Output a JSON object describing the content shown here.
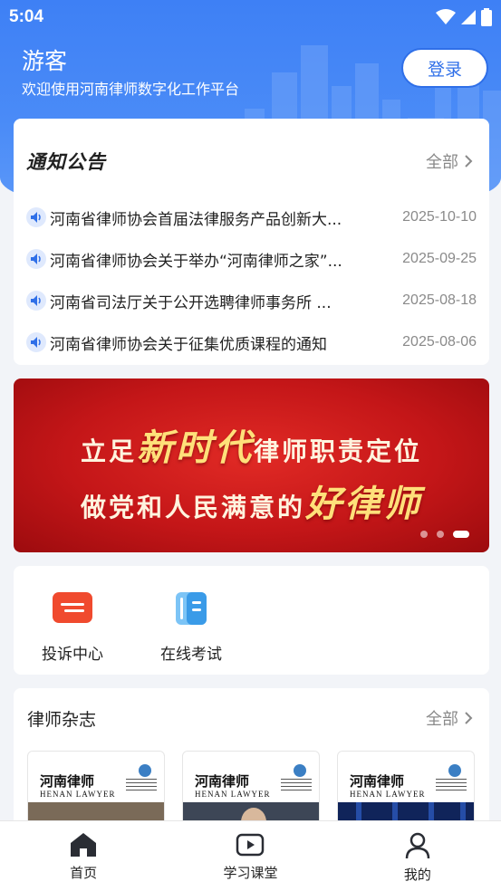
{
  "status_bar": {
    "time": "5:04"
  },
  "header": {
    "user_name": "游客",
    "welcome": "欢迎使用河南律师数字化工作平台",
    "login_label": "登录"
  },
  "notices": {
    "title": "通知公告",
    "more_label": "全部",
    "items": [
      {
        "text": "河南省律师协会首届法律服务产品创新大...",
        "date": "2025-10-10"
      },
      {
        "text": "河南省律师协会关于举办“河南律师之家”...",
        "date": "2025-09-25"
      },
      {
        "text": "河南省司法厅关于公开选聘律师事务所 ...",
        "date": "2025-08-18"
      },
      {
        "text": "河南省律师协会关于征集优质课程的通知",
        "date": "2025-08-06"
      }
    ]
  },
  "banner": {
    "line1_a": "立足",
    "line1_accent": "新时代",
    "line1_b": "律师职责定位",
    "line2_a": "做党和人民满意的",
    "line2_accent": "好律师",
    "slide_count": 3,
    "active_slide": 3
  },
  "quick_actions": [
    {
      "label": "投诉中心",
      "icon": "complaint-icon",
      "color": "#f04a2e"
    },
    {
      "label": "在线考试",
      "icon": "exam-icon",
      "color": "#4aa8ef"
    }
  ],
  "magazines": {
    "title": "律师杂志",
    "more_label": "全部",
    "items": [
      {
        "name": "河南律师",
        "name_en": "HENAN LAWYER"
      },
      {
        "name": "河南律师",
        "name_en": "HENAN LAWYER"
      },
      {
        "name": "河南律师",
        "name_en": "HENAN LAWYER"
      }
    ]
  },
  "bottom_nav": [
    {
      "label": "首页",
      "icon": "home-icon",
      "active": true
    },
    {
      "label": "学习课堂",
      "icon": "play-icon",
      "active": false
    },
    {
      "label": "我的",
      "icon": "user-icon",
      "active": false
    }
  ],
  "colors": {
    "primary": "#3e80f5",
    "banner_red": "#c41618",
    "accent_gold": "#ffe07a"
  }
}
